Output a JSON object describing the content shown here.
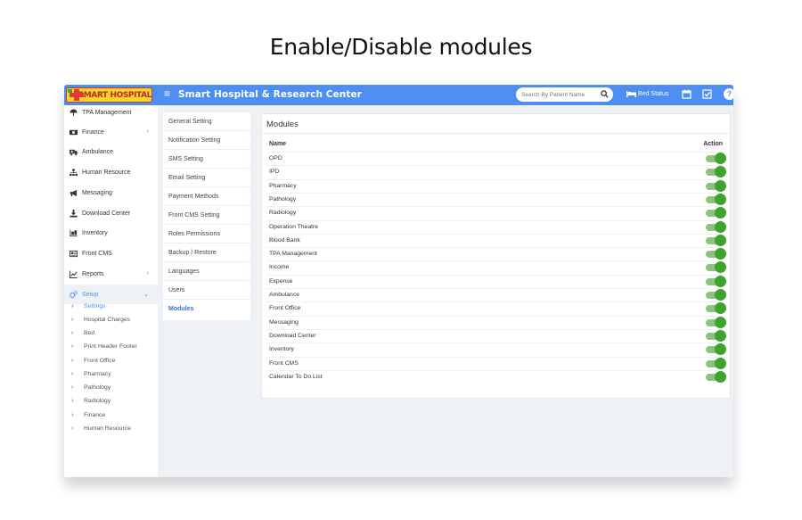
{
  "heading": "Enable/Disable modules",
  "topbar": {
    "logo_text": "SMART HOSPITAL",
    "app_title": "Smart Hospital & Research Center",
    "search_placeholder": "Search By Patient Name",
    "bed_status_label": "Bed Status",
    "help_label": "?",
    "accent_color": "#4e8ef0"
  },
  "sidebar": {
    "items": [
      {
        "label": "TPA Management",
        "icon": "umbrella-icon"
      },
      {
        "label": "Finance",
        "icon": "money-icon",
        "has_chevron": true
      },
      {
        "label": "Ambulance",
        "icon": "ambulance-icon"
      },
      {
        "label": "Human Resource",
        "icon": "sitemap-icon"
      },
      {
        "label": "Messaging",
        "icon": "bullhorn-icon"
      },
      {
        "label": "Download Center",
        "icon": "download-icon"
      },
      {
        "label": "Inventory",
        "icon": "inventory-icon"
      },
      {
        "label": "Front CMS",
        "icon": "newspaper-icon"
      },
      {
        "label": "Reports",
        "icon": "line-chart-icon",
        "has_chevron": true
      },
      {
        "label": "Setup",
        "icon": "gears-icon",
        "has_chevron": true,
        "active": true
      }
    ],
    "sub_items": [
      {
        "label": "Settings",
        "active": true
      },
      {
        "label": "Hospital Charges"
      },
      {
        "label": "Bed"
      },
      {
        "label": "Print Header Footer"
      },
      {
        "label": "Front Office"
      },
      {
        "label": "Pharmacy"
      },
      {
        "label": "Pathology"
      },
      {
        "label": "Radiology"
      },
      {
        "label": "Finance"
      },
      {
        "label": "Human Resource"
      }
    ]
  },
  "settings_menu": {
    "items": [
      {
        "label": "General Setting"
      },
      {
        "label": "Notification Setting"
      },
      {
        "label": "SMS Setting"
      },
      {
        "label": "Email Setting"
      },
      {
        "label": "Payment Methods"
      },
      {
        "label": "Front CMS Setting"
      },
      {
        "label": "Roles Permissions"
      },
      {
        "label": "Backup / Restore"
      },
      {
        "label": "Languages"
      },
      {
        "label": "Users"
      },
      {
        "label": "Modules",
        "active": true
      }
    ]
  },
  "modules_panel": {
    "title": "Modules",
    "col_name": "Name",
    "col_action": "Action",
    "toggle_color": "#3fa22e",
    "rows": [
      {
        "name": "OPD",
        "enabled": true
      },
      {
        "name": "IPD",
        "enabled": true
      },
      {
        "name": "Pharmacy",
        "enabled": true
      },
      {
        "name": "Pathology",
        "enabled": true
      },
      {
        "name": "Radiology",
        "enabled": true
      },
      {
        "name": "Operation Theatre",
        "enabled": true
      },
      {
        "name": "Blood Bank",
        "enabled": true
      },
      {
        "name": "TPA Management",
        "enabled": true
      },
      {
        "name": "Income",
        "enabled": true
      },
      {
        "name": "Expense",
        "enabled": true
      },
      {
        "name": "Ambulance",
        "enabled": true
      },
      {
        "name": "Front Office",
        "enabled": true
      },
      {
        "name": "Messaging",
        "enabled": true
      },
      {
        "name": "Download Center",
        "enabled": true
      },
      {
        "name": "Inventory",
        "enabled": true
      },
      {
        "name": "Front CMS",
        "enabled": true
      },
      {
        "name": "Calendar To Do List",
        "enabled": true
      }
    ]
  }
}
